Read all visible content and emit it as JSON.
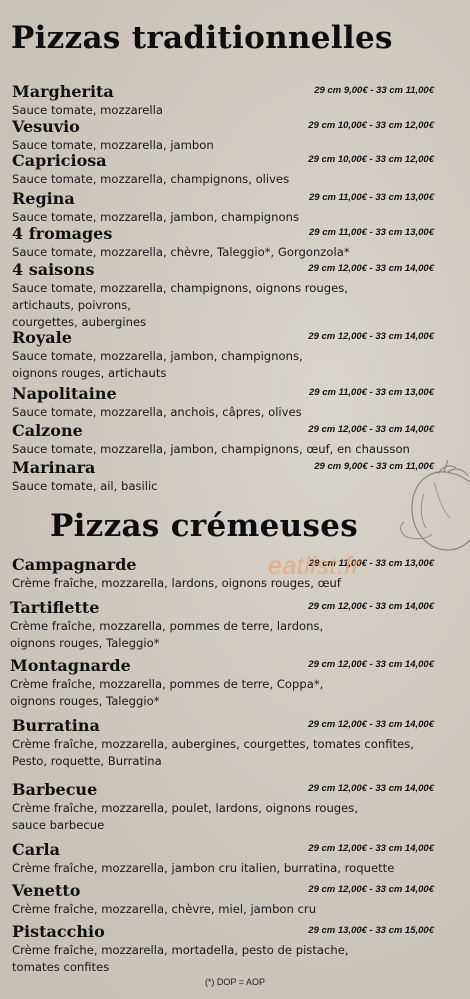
{
  "sections": [
    {
      "title": "Pizzas traditionnelles",
      "items": [
        {
          "name": "Margherita",
          "price": "29 cm 9,00€ - 33 cm 11,00€",
          "desc": [
            "Sauce tomate, mozzarella"
          ]
        },
        {
          "name": "Vesuvio",
          "price": "29 cm 10,00€ - 33 cm 12,00€",
          "desc": [
            "Sauce tomate, mozzarella, jambon"
          ]
        },
        {
          "name": "Capriciosa",
          "price": "29 cm 10,00€ - 33 cm 12,00€",
          "desc": [
            "Sauce tomate, mozzarella, champignons, olives"
          ]
        },
        {
          "name": "Regina",
          "price": "29 cm 11,00€ - 33 cm 13,00€",
          "desc": [
            "Sauce tomate, mozzarella, jambon, champignons"
          ]
        },
        {
          "name": "4 fromages",
          "price": "29 cm 11,00€ - 33 cm 13,00€",
          "desc": [
            "Sauce tomate, mozzarella, chèvre, Taleggio*, Gorgonzola*"
          ]
        },
        {
          "name": "4 saisons",
          "price": "29 cm 12,00€ - 33 cm 14,00€",
          "desc": [
            "Sauce tomate, mozzarella, champignons, oignons rouges,",
            "artichauts, poivrons,",
            "courgettes, aubergines"
          ]
        },
        {
          "name": "Royale",
          "price": "29 cm 12,00€ - 33 cm 14,00€",
          "desc": [
            "Sauce tomate, mozzarella, jambon, champignons,",
            "oignons rouges, artichauts"
          ]
        },
        {
          "name": "Napolitaine",
          "price": "29 cm 11,00€ - 33 cm 13,00€",
          "desc": [
            "Sauce tomate, mozzarella, anchois, câpres, olives"
          ]
        },
        {
          "name": "Calzone",
          "price": "29 cm 12,00€ - 33 cm 14,00€",
          "desc": [
            "Sauce tomate, mozzarella, jambon, champignons, œuf, en chausson"
          ]
        },
        {
          "name": "Marinara",
          "price": "29 cm 9,00€ - 33 cm 11,00€",
          "desc": [
            "Sauce tomate, ail, basilic"
          ]
        }
      ]
    },
    {
      "title": "Pizzas crémeuses",
      "items": [
        {
          "name": "Campagnarde",
          "price": "29 cm 11,00€ - 33 cm 13,00€",
          "desc": [
            "Crème fraîche, mozzarella, lardons, oignons rouges, œuf"
          ]
        },
        {
          "name": "Tartiflette",
          "price": "29 cm 12,00€ - 33 cm 14,00€",
          "desc": [
            "Crème fraîche, mozzarella, pommes de terre, lardons,",
            "oignons rouges, Taleggio*"
          ]
        },
        {
          "name": "Montagnarde",
          "price": "29 cm 12,00€ - 33 cm 14,00€",
          "desc": [
            "Crème fraîche, mozzarella, pommes de terre, Coppa*,",
            "oignons rouges, Taleggio*"
          ]
        },
        {
          "name": "Burratina",
          "price": "29 cm 12,00€ - 33 cm 14,00€",
          "desc": [
            "Crème fraîche, mozzarella, aubergines, courgettes, tomates confites,",
            "Pesto, roquette, Burratina"
          ]
        },
        {
          "name": "Barbecue",
          "price": "29 cm 12,00€ - 33 cm 14,00€",
          "desc": [
            "Crème fraîche, mozzarella, poulet, lardons, oignons rouges,",
            "sauce barbecue"
          ]
        },
        {
          "name": "Carla",
          "price": "29 cm 12,00€ - 33 cm 14,00€",
          "desc": [
            "Crème fraîche, mozzarella, jambon cru italien, burratina, roquette"
          ]
        },
        {
          "name": "Venetto",
          "price": "29 cm 12,00€ - 33 cm 14,00€",
          "desc": [
            "Crème fraîche, mozzarella, chèvre, miel, jambon cru"
          ]
        },
        {
          "name": "Pistacchio",
          "price": "29 cm 13,00€ - 33 cm 15,00€",
          "desc": [
            "Crème fraîche, mozzarella, mortadella, pesto de pistache,",
            "tomates confites"
          ]
        }
      ]
    }
  ],
  "footnote": "(*) DOP = AOP",
  "watermark": "eatlist.fr",
  "colors": {
    "background": "#cfc9c0",
    "text": "#111111",
    "watermark": "#e8a36e"
  },
  "decoration": "tomato-sketch-icon"
}
